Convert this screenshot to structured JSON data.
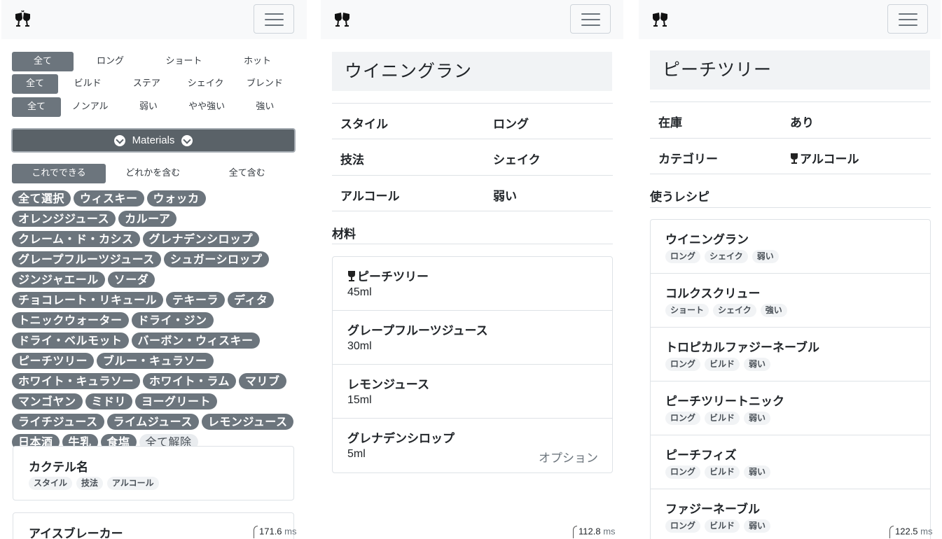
{
  "panel1": {
    "filters": {
      "style": [
        "全て",
        "ロング",
        "ショート",
        "ホット"
      ],
      "method": [
        "全て",
        "ビルド",
        "ステア",
        "シェイク",
        "ブレンド"
      ],
      "alcohol": [
        "全て",
        "ノンアル",
        "弱い",
        "やや強い",
        "強い"
      ]
    },
    "materials_button": "Materials",
    "match_modes": [
      "これでできる",
      "どれかを含む",
      "全て含む"
    ],
    "chips": [
      "全て選択",
      "ウィスキー",
      "ウォッカ",
      "オレンジジュース",
      "カルーア",
      "クレーム・ド・カシス",
      "グレナデンシロップ",
      "グレープフルーツジュース",
      "シュガーシロップ",
      "ジンジャエール",
      "ソーダ",
      "チョコレート・リキュール",
      "テキーラ",
      "ディタ",
      "トニックウォーター",
      "ドライ・ジン",
      "ドライ・ベルモット",
      "バーボン・ウィスキー",
      "ピーチツリー",
      "ブルー・キュラソー",
      "ホワイト・キュラソー",
      "ホワイト・ラム",
      "マリブ",
      "マンゴヤン",
      "ミドリ",
      "ヨーグリート",
      "ライチジュース",
      "ライムジュース",
      "レモンジュース",
      "日本酒",
      "牛乳",
      "食塩"
    ],
    "clear_chip": "全て解除",
    "header_card": {
      "title": "カクテル名",
      "tags": [
        "スタイル",
        "技法",
        "アルコール"
      ]
    },
    "next_card_title": "アイスブレーカー",
    "timer_value": "171.6",
    "timer_unit": "ms"
  },
  "panel2": {
    "title": "ウイニングラン",
    "rows": [
      {
        "k": "スタイル",
        "v": "ロング"
      },
      {
        "k": "技法",
        "v": "シェイク"
      },
      {
        "k": "アルコール",
        "v": "弱い"
      }
    ],
    "section": "材料",
    "materials": [
      {
        "name": "ピーチツリー",
        "amount": "45ml",
        "note": ""
      },
      {
        "name": "グレープフルーツジュース",
        "amount": "30ml",
        "note": ""
      },
      {
        "name": "レモンジュース",
        "amount": "15ml",
        "note": ""
      },
      {
        "name": "グレナデンシロップ",
        "amount": "5ml",
        "note": "オプション"
      }
    ],
    "timer_value": "112.8",
    "timer_unit": "ms"
  },
  "panel3": {
    "title": "ピーチツリー",
    "rows": [
      {
        "k": "在庫",
        "v": "あり"
      },
      {
        "k": "カテゴリー",
        "v": "アルコール"
      }
    ],
    "section": "使うレシピ",
    "recipes": [
      {
        "name": "ウイニングラン",
        "tags": [
          "ロング",
          "シェイク",
          "弱い"
        ]
      },
      {
        "name": "コルクスクリュー",
        "tags": [
          "ショート",
          "シェイク",
          "強い"
        ]
      },
      {
        "name": "トロピカルファジーネーブル",
        "tags": [
          "ロング",
          "ビルド",
          "弱い"
        ]
      },
      {
        "name": "ピーチツリートニック",
        "tags": [
          "ロング",
          "ビルド",
          "弱い"
        ]
      },
      {
        "name": "ピーチフィズ",
        "tags": [
          "ロング",
          "ビルド",
          "弱い"
        ]
      },
      {
        "name": "ファジーネーブル",
        "tags": [
          "ロング",
          "ビルド",
          "弱い"
        ]
      }
    ],
    "timer_value": "122.5",
    "timer_unit": "ms"
  }
}
